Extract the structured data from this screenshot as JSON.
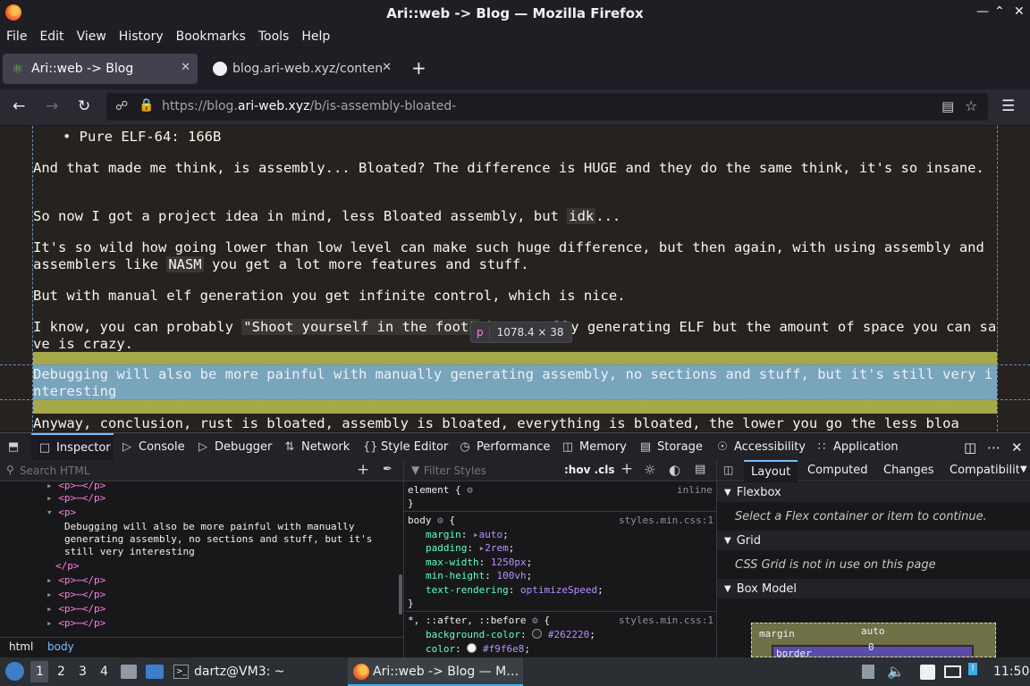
{
  "window": {
    "title": "Ari::web -> Blog — Mozilla Firefox"
  },
  "menu": [
    "File",
    "Edit",
    "View",
    "History",
    "Bookmarks",
    "Tools",
    "Help"
  ],
  "tabs": [
    {
      "label": "Ari::web -> Blog",
      "active": true
    },
    {
      "label": "blog.ari-web.xyz/content",
      "active": false
    }
  ],
  "url": {
    "prefix": "https://blog.",
    "domain": "ari-web.xyz",
    "path": "/b/is-assembly-bloated-"
  },
  "page": {
    "bullet": "Pure ELF-64: 166B",
    "p1": "And that made me think, is assembly... Bloated? The difference is HUGE and they do the same think, it's so insane.",
    "p2a": "So now I got a project idea in mind, less Bloated assembly, but ",
    "p2code": "idk",
    "p2b": "...",
    "p3a": "It's so wild how going lower than low level can make such huge difference, but then again, with using assembly and assemblers like ",
    "p3code": "NASM",
    "p3b": " you get a lot more features and stuff.",
    "p4": "But with manual elf generation you get infinite control, which is nice.",
    "p5a": "I know, you can probably ",
    "p5code": "\"Shoot yourself in the foot\"",
    "p5b": " by manually generating ELF but the amount of space you can save is crazy.",
    "p6": "Debugging will also be more painful with manually generating assembly, no sections and stuff, but it's still very interesting",
    "p7": "Anyway, conclusion, rust is bloated, assembly is bloated, everything is bloated, the lower you go the less bloa",
    "tooltip_tag": "p",
    "tooltip_size": "1078.4 × 38"
  },
  "devtools": {
    "tabs": [
      "Inspector",
      "Console",
      "Debugger",
      "Network",
      "Style Editor",
      "Performance",
      "Memory",
      "Storage",
      "Accessibility",
      "Application"
    ],
    "search_placeholder": "Search HTML",
    "filter_placeholder": "Filter Styles",
    "hov_cls": ":hov .cls",
    "tree": {
      "collapsed_p": "<p>⋯</p>",
      "open_p": "<p>",
      "text1": "Debugging will also be more painful with manually",
      "text2": "generating assembly, no sections and stuff, but it's",
      "text3": "still very interesting",
      "close_p": "</p>"
    },
    "breadcrumbs": [
      "html",
      "body"
    ],
    "rules": {
      "element_sel": "element {",
      "element_src": "inline",
      "body_sel": "body",
      "body_src": "styles.min.css:1",
      "body_decls": [
        {
          "p": "margin",
          "v": "auto"
        },
        {
          "p": "padding",
          "v": "2rem"
        },
        {
          "p": "max-width",
          "v": "1250px"
        },
        {
          "p": "min-height",
          "v": "100vh"
        },
        {
          "p": "text-rendering",
          "v": "optimizeSpeed"
        }
      ],
      "univ_sel": "*, ::after, ::before",
      "univ_src": "styles.min.css:1",
      "univ_decls": [
        {
          "p": "background-color",
          "v": "#262220",
          "swatch": "#262220"
        },
        {
          "p": "color",
          "v": "#f9f6e8",
          "swatch": "#f9f6e8"
        }
      ]
    },
    "layout_tabs": [
      "Layout",
      "Computed",
      "Changes",
      "Compatibility"
    ],
    "flexbox_title": "Flexbox",
    "flexbox_msg": "Select a Flex container or item to continue.",
    "grid_title": "Grid",
    "grid_msg": "CSS Grid is not in use on this page",
    "boxmodel_title": "Box Model",
    "box": {
      "margin_label": "margin",
      "margin_top": "auto",
      "border_label": "border",
      "border_top": "0"
    }
  },
  "taskbar": {
    "desktops": [
      "1",
      "2",
      "3",
      "4"
    ],
    "terminal": "dartz@VM3: ~",
    "firefox": "Ari::web -> Blog — M…",
    "clock": "11:50"
  },
  "colors": {
    "page_bg": "#262220",
    "page_fg": "#f9f6e8",
    "accent": "#75bfff"
  }
}
